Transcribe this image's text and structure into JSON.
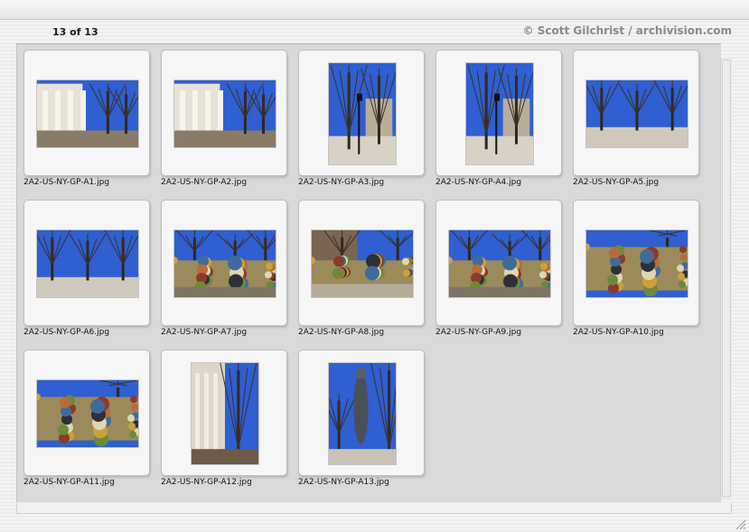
{
  "header": {
    "counter": "13 of 13",
    "copyright": "© Scott Gilchrist / archivision.com"
  },
  "thumbnails": [
    {
      "filename": "2A2-US-NY-GP-A1.jpg",
      "orientation": "landscape",
      "scene": "building-columns"
    },
    {
      "filename": "2A2-US-NY-GP-A2.jpg",
      "orientation": "landscape",
      "scene": "building-columns"
    },
    {
      "filename": "2A2-US-NY-GP-A3.jpg",
      "orientation": "portrait",
      "scene": "park-lamp"
    },
    {
      "filename": "2A2-US-NY-GP-A4.jpg",
      "orientation": "portrait",
      "scene": "park-lamp"
    },
    {
      "filename": "2A2-US-NY-GP-A5.jpg",
      "orientation": "landscape",
      "scene": "park-trees"
    },
    {
      "filename": "2A2-US-NY-GP-A6.jpg",
      "orientation": "landscape",
      "scene": "park-trees"
    },
    {
      "filename": "2A2-US-NY-GP-A7.jpg",
      "orientation": "landscape",
      "scene": "mosaic-wall"
    },
    {
      "filename": "2A2-US-NY-GP-A8.jpg",
      "orientation": "landscape",
      "scene": "mosaic-path"
    },
    {
      "filename": "2A2-US-NY-GP-A9.jpg",
      "orientation": "landscape",
      "scene": "mosaic-wall"
    },
    {
      "filename": "2A2-US-NY-GP-A10.jpg",
      "orientation": "landscape",
      "scene": "mosaic-closeup"
    },
    {
      "filename": "2A2-US-NY-GP-A11.jpg",
      "orientation": "landscape",
      "scene": "mosaic-closeup"
    },
    {
      "filename": "2A2-US-NY-GP-A12.jpg",
      "orientation": "portrait",
      "scene": "building-tree"
    },
    {
      "filename": "2A2-US-NY-GP-A13.jpg",
      "orientation": "portrait",
      "scene": "sculpture"
    }
  ],
  "colors": {
    "sky": "#2f5fd0",
    "panel": "#d9d9d9",
    "card": "#f6f6f6",
    "copyright": "#8a8a8a"
  }
}
